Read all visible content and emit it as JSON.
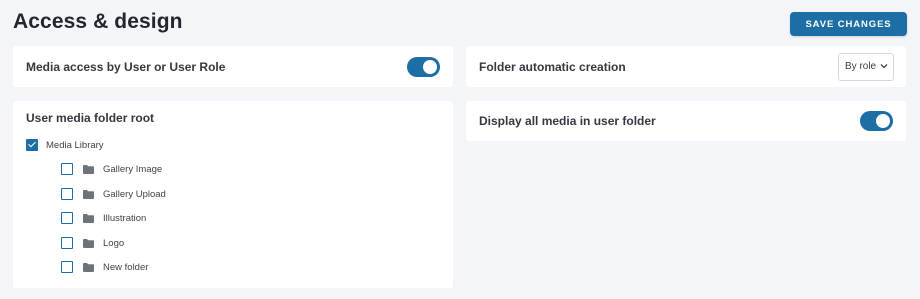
{
  "header": {
    "title": "Access & design",
    "save_label": "SAVE CHANGES"
  },
  "settings": {
    "media_access": {
      "label": "Media access by User or User Role",
      "enabled": true
    },
    "folder_auto_creation": {
      "label": "Folder automatic creation",
      "selected_option": "By role"
    },
    "display_all_media": {
      "label": "Display all media in user folder",
      "enabled": true
    }
  },
  "folder_root": {
    "title": "User media folder root",
    "root": {
      "label": "Media Library",
      "checked": true
    },
    "children": [
      {
        "label": "Gallery Image",
        "checked": false
      },
      {
        "label": "Gallery Upload",
        "checked": false
      },
      {
        "label": "Illustration",
        "checked": false
      },
      {
        "label": "Logo",
        "checked": false
      },
      {
        "label": "New folder",
        "checked": false
      }
    ]
  },
  "colors": {
    "accent": "#1c6ea4",
    "background": "#f3f5f9",
    "card": "#ffffff",
    "folder_icon": "#6d737b"
  },
  "icons": {
    "select_arrow": "chevron-down-icon",
    "folder": "folder-icon",
    "check": "checkmark-icon"
  }
}
